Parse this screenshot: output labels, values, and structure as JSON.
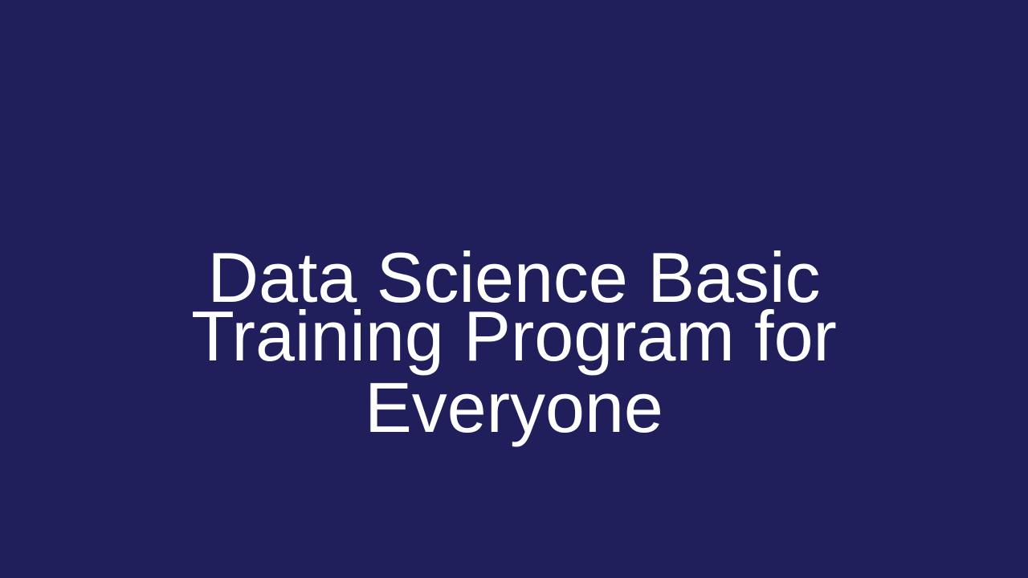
{
  "slide": {
    "background_color": "#201F5B",
    "text_color": "#FFFFFF",
    "title_lines": [
      "Data Science Basic",
      "Training Program for",
      "Everyone"
    ]
  }
}
